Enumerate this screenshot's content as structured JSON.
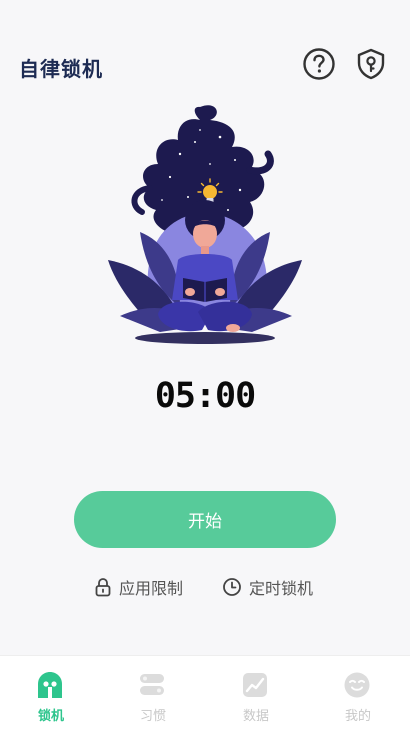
{
  "app": {
    "title": "自律锁机"
  },
  "header": {
    "help_icon": "help-circle-icon",
    "shield_icon": "shield-key-icon"
  },
  "timer": {
    "value": "05:00"
  },
  "start_button": {
    "label": "开始"
  },
  "options": [
    {
      "icon": "lock-icon",
      "label": "应用限制"
    },
    {
      "icon": "clock-icon",
      "label": "定时锁机"
    }
  ],
  "tabs": [
    {
      "icon": "lock-tab-icon",
      "label": "锁机",
      "active": true
    },
    {
      "icon": "habit-icon",
      "label": "习惯",
      "active": false
    },
    {
      "icon": "chart-icon",
      "label": "数据",
      "active": false
    },
    {
      "icon": "profile-face-icon",
      "label": "我的",
      "active": false
    }
  ],
  "colors": {
    "accent": "#57cb9a",
    "active_tab": "#2ec58d",
    "title": "#1d2b53",
    "night": "#1d1a4f",
    "petals": "#8a86e0"
  }
}
